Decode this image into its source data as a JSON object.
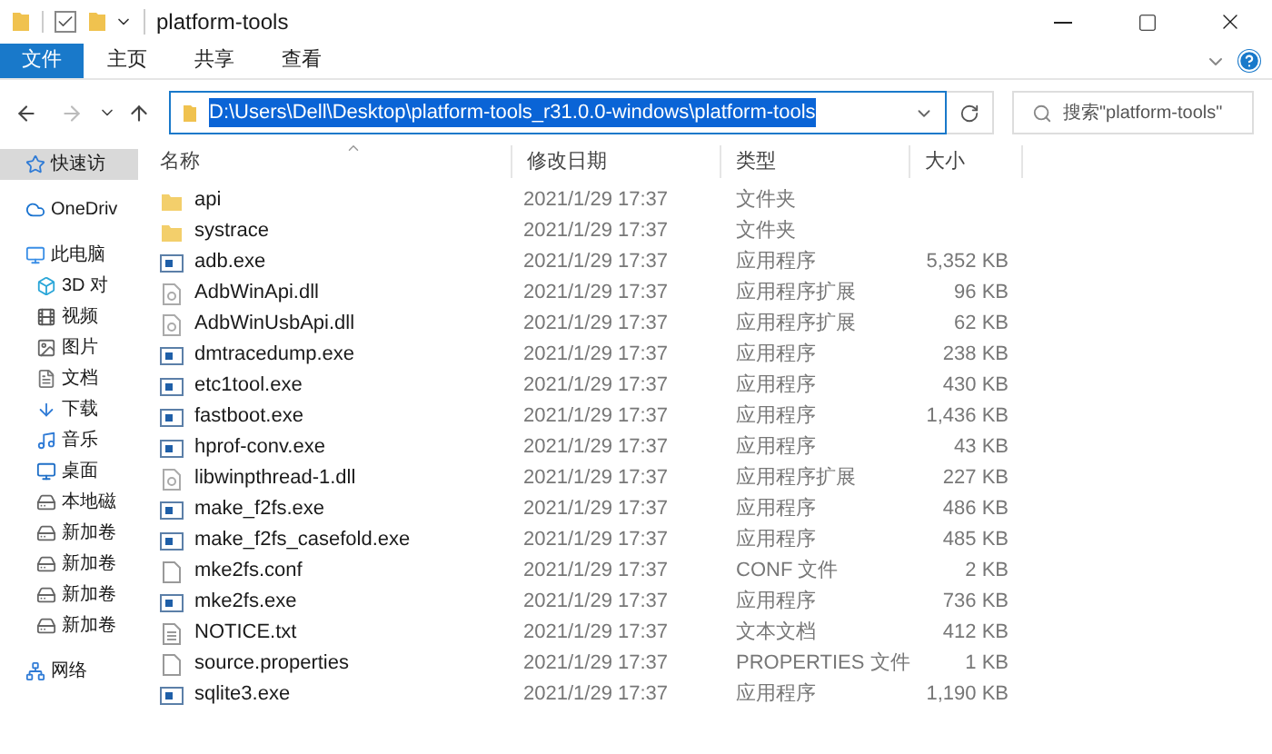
{
  "window": {
    "title": "platform-tools"
  },
  "ribbon_tabs": [
    {
      "label": "文件",
      "selected": true
    },
    {
      "label": "主页",
      "selected": false
    },
    {
      "label": "共享",
      "selected": false
    },
    {
      "label": "查看",
      "selected": false
    }
  ],
  "address": {
    "value": "D:\\Users\\Dell\\Desktop\\platform-tools_r31.0.0-windows\\platform-tools"
  },
  "search": {
    "placeholder": "搜索\"platform-tools\""
  },
  "sidebar": {
    "items": [
      {
        "kind": "star",
        "label": "快速访",
        "selected": true
      },
      {
        "kind": "cloud",
        "label": "OneDriv",
        "selected": false
      },
      {
        "kind": "pc",
        "label": "此电脑",
        "selected": false
      },
      {
        "kind": "cube",
        "label": "3D 对",
        "selected": false
      },
      {
        "kind": "video",
        "label": "视频",
        "selected": false
      },
      {
        "kind": "image",
        "label": "图片",
        "selected": false
      },
      {
        "kind": "doc",
        "label": "文档",
        "selected": false
      },
      {
        "kind": "download",
        "label": "下载",
        "selected": false
      },
      {
        "kind": "music",
        "label": "音乐",
        "selected": false
      },
      {
        "kind": "desktop",
        "label": "桌面",
        "selected": false
      },
      {
        "kind": "drive",
        "label": "本地磁",
        "selected": false
      },
      {
        "kind": "drive",
        "label": "新加卷",
        "selected": false
      },
      {
        "kind": "drive",
        "label": "新加卷",
        "selected": false
      },
      {
        "kind": "drive",
        "label": "新加卷",
        "selected": false
      },
      {
        "kind": "drive",
        "label": "新加卷",
        "selected": false
      },
      {
        "kind": "network",
        "label": "网络",
        "selected": false
      }
    ]
  },
  "table": {
    "columns": [
      "名称",
      "修改日期",
      "类型",
      "大小"
    ],
    "rows": [
      {
        "kind": "folder",
        "name": "api",
        "modified": "2021/1/29 17:37",
        "type": "文件夹"
      },
      {
        "kind": "folder",
        "name": "systrace",
        "modified": "2021/1/29 17:37",
        "type": "文件夹"
      },
      {
        "kind": "exe",
        "name": "adb.exe",
        "modified": "2021/1/29 17:37",
        "type": "应用程序",
        "size": "5,352 KB"
      },
      {
        "kind": "dll",
        "name": "AdbWinApi.dll",
        "modified": "2021/1/29 17:37",
        "type": "应用程序扩展",
        "size": "96 KB"
      },
      {
        "kind": "dll",
        "name": "AdbWinUsbApi.dll",
        "modified": "2021/1/29 17:37",
        "type": "应用程序扩展",
        "size": "62 KB"
      },
      {
        "kind": "exe",
        "name": "dmtracedump.exe",
        "modified": "2021/1/29 17:37",
        "type": "应用程序",
        "size": "238 KB"
      },
      {
        "kind": "exe",
        "name": "etc1tool.exe",
        "modified": "2021/1/29 17:37",
        "type": "应用程序",
        "size": "430 KB"
      },
      {
        "kind": "exe",
        "name": "fastboot.exe",
        "modified": "2021/1/29 17:37",
        "type": "应用程序",
        "size": "1,436 KB"
      },
      {
        "kind": "exe",
        "name": "hprof-conv.exe",
        "modified": "2021/1/29 17:37",
        "type": "应用程序",
        "size": "43 KB"
      },
      {
        "kind": "dll",
        "name": "libwinpthread-1.dll",
        "modified": "2021/1/29 17:37",
        "type": "应用程序扩展",
        "size": "227 KB"
      },
      {
        "kind": "exe",
        "name": "make_f2fs.exe",
        "modified": "2021/1/29 17:37",
        "type": "应用程序",
        "size": "486 KB"
      },
      {
        "kind": "exe",
        "name": "make_f2fs_casefold.exe",
        "modified": "2021/1/29 17:37",
        "type": "应用程序",
        "size": "485 KB"
      },
      {
        "kind": "file",
        "name": "mke2fs.conf",
        "modified": "2021/1/29 17:37",
        "type": "CONF 文件",
        "size": "2 KB"
      },
      {
        "kind": "exe",
        "name": "mke2fs.exe",
        "modified": "2021/1/29 17:37",
        "type": "应用程序",
        "size": "736 KB"
      },
      {
        "kind": "txt",
        "name": "NOTICE.txt",
        "modified": "2021/1/29 17:37",
        "type": "文本文档",
        "size": "412 KB"
      },
      {
        "kind": "file",
        "name": "source.properties",
        "modified": "2021/1/29 17:37",
        "type": "PROPERTIES 文件",
        "size": "1 KB"
      },
      {
        "kind": "exe",
        "name": "sqlite3.exe",
        "modified": "2021/1/29 17:37",
        "type": "应用程序",
        "size": "1,190 KB"
      }
    ]
  }
}
